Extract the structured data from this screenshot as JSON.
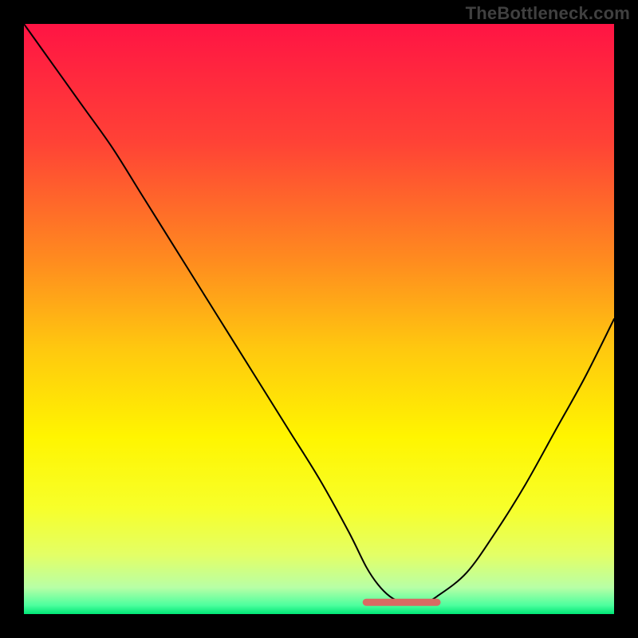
{
  "watermark": "TheBottleneck.com",
  "colors": {
    "frame_background": "#000000",
    "curve": "#000000",
    "marker": "#d96a63",
    "gradient_stops": [
      {
        "offset": 0.0,
        "color": "#ff1444"
      },
      {
        "offset": 0.2,
        "color": "#ff4236"
      },
      {
        "offset": 0.4,
        "color": "#ff8b1f"
      },
      {
        "offset": 0.55,
        "color": "#ffc80f"
      },
      {
        "offset": 0.7,
        "color": "#fff500"
      },
      {
        "offset": 0.82,
        "color": "#f7ff2a"
      },
      {
        "offset": 0.9,
        "color": "#e3ff66"
      },
      {
        "offset": 0.955,
        "color": "#b8ffa6"
      },
      {
        "offset": 0.985,
        "color": "#4dff9e"
      },
      {
        "offset": 1.0,
        "color": "#00e676"
      }
    ]
  },
  "chart_data": {
    "type": "line",
    "title": "",
    "xlabel": "",
    "ylabel": "",
    "xlim": [
      0,
      100
    ],
    "ylim": [
      0,
      100
    ],
    "series": [
      {
        "name": "bottleneck_curve",
        "x": [
          0,
          5,
          10,
          15,
          20,
          25,
          30,
          35,
          40,
          45,
          50,
          55,
          58,
          60,
          62,
          64,
          66,
          68,
          70,
          75,
          80,
          85,
          90,
          95,
          100
        ],
        "y": [
          100,
          93,
          86,
          79,
          71,
          63,
          55,
          47,
          39,
          31,
          23,
          14,
          8,
          5,
          3,
          2,
          2,
          2,
          3,
          7,
          14,
          22,
          31,
          40,
          50
        ]
      }
    ],
    "optimal_range": {
      "x_start": 58,
      "x_end": 70,
      "y": 2
    }
  }
}
